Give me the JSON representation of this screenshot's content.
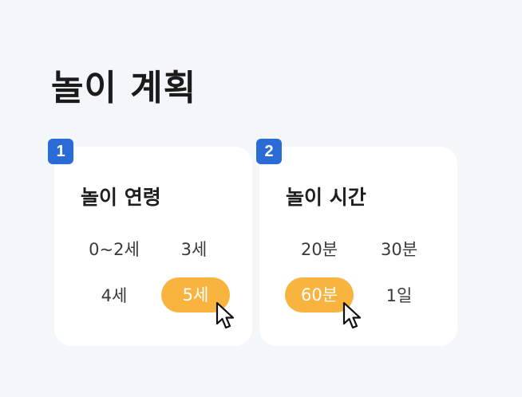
{
  "page": {
    "title": "놀이 계획"
  },
  "cards": [
    {
      "step": "1",
      "title": "놀이 연령",
      "options": [
        "0~2세",
        "3세",
        "4세",
        "5세"
      ],
      "selected": "5세"
    },
    {
      "step": "2",
      "title": "놀이 시간",
      "options": [
        "20분",
        "30분",
        "60분",
        "1일"
      ],
      "selected": "60분"
    }
  ],
  "colors": {
    "accent": "#f9b440",
    "badge": "#2a6bd6",
    "background": "#f4f7f9"
  }
}
